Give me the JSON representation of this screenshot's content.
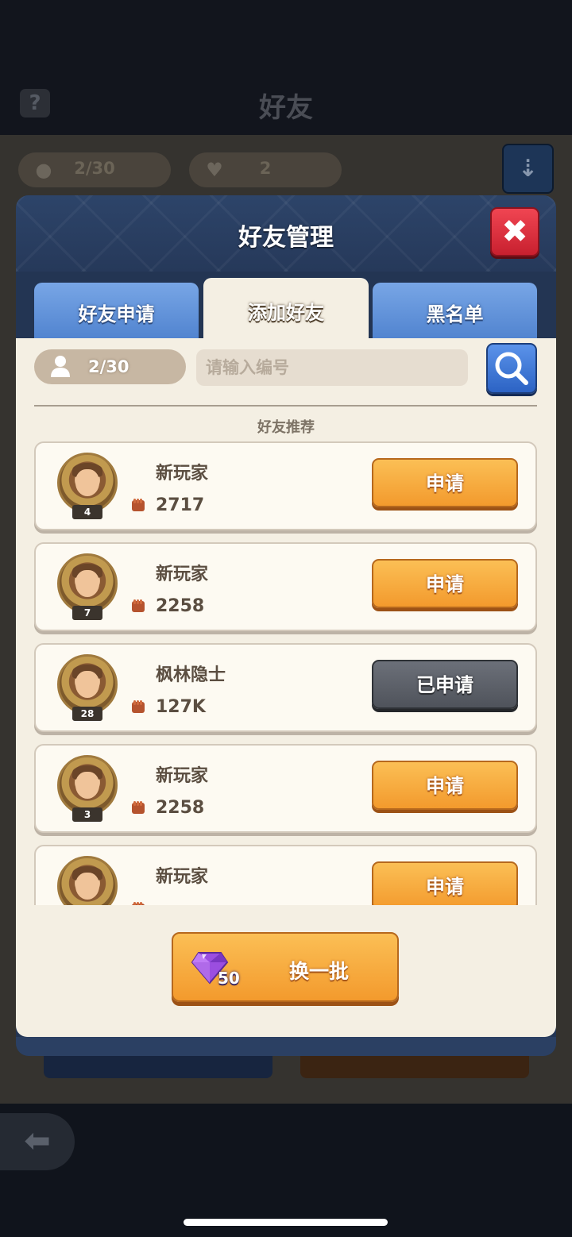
{
  "background": {
    "title": "好友",
    "friend_count": "2/30",
    "likes_count": "2"
  },
  "modal": {
    "title": "好友管理",
    "tabs": [
      {
        "label": "好友申请",
        "active": false
      },
      {
        "label": "添加好友",
        "active": true
      },
      {
        "label": "黑名单",
        "active": false
      }
    ],
    "friend_count": "2/30",
    "search": {
      "value": "",
      "placeholder": "请输入编号"
    },
    "recommend_label": "好友推荐",
    "players": [
      {
        "name": "新玩家",
        "level": "4",
        "power": "2717",
        "action": "申请",
        "status": "available"
      },
      {
        "name": "新玩家",
        "level": "7",
        "power": "2258",
        "action": "申请",
        "status": "available"
      },
      {
        "name": "枫林隐士",
        "level": "28",
        "power": "127K",
        "action": "已申请",
        "status": "applied"
      },
      {
        "name": "新玩家",
        "level": "3",
        "power": "2258",
        "action": "申请",
        "status": "available"
      },
      {
        "name": "新玩家",
        "level": "",
        "power": "",
        "action": "申请",
        "status": "available"
      }
    ],
    "refresh": {
      "cost": "50",
      "label": "换一批"
    }
  },
  "colors": {
    "accent_orange": "#f5a63a",
    "tab_blue": "#5f93dc",
    "close_red": "#e0323f",
    "panel_bg": "#f4efe3",
    "applied_gray": "#5d6168"
  },
  "icons": {
    "help": "help-icon",
    "likes": "heart-icon",
    "sort": "sort-icon",
    "close": "close-icon",
    "search": "search-icon",
    "power": "fist-icon",
    "gem": "gem-icon",
    "back": "back-arrow-icon"
  }
}
